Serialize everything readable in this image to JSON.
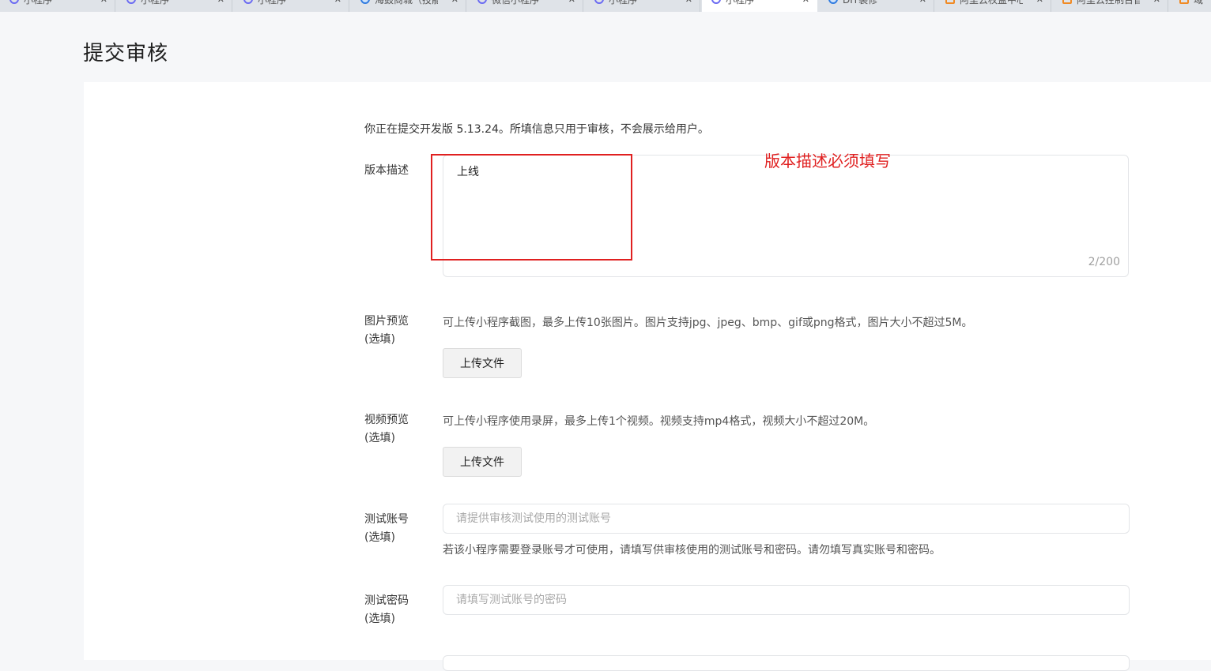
{
  "browser": {
    "tabs": [
      {
        "label": "小程序",
        "icon": "miniprogram-icon",
        "active": false
      },
      {
        "label": "小程序",
        "icon": "miniprogram-icon",
        "active": false
      },
      {
        "label": "小程序",
        "icon": "miniprogram-icon",
        "active": false
      },
      {
        "label": "海鼓商城（技能",
        "icon": "globe-icon",
        "active": false
      },
      {
        "label": "微信小程序",
        "icon": "miniprogram-icon",
        "active": false
      },
      {
        "label": "小程序",
        "icon": "miniprogram-icon",
        "active": false
      },
      {
        "label": "小程序",
        "icon": "miniprogram-icon",
        "active": true
      },
      {
        "label": "DIY装修",
        "icon": "globe-icon",
        "active": false
      },
      {
        "label": "阿里云权益中心",
        "icon": "bracket-icon",
        "active": false
      },
      {
        "label": "阿里云控制台首",
        "icon": "bracket-icon",
        "active": false
      },
      {
        "label": "域",
        "icon": "bracket-icon",
        "active": false
      }
    ],
    "close_glyph": "✕"
  },
  "page": {
    "title": "提交审核",
    "intro": "你正在提交开发版 5.13.24。所填信息只用于审核，不会展示给用户。"
  },
  "form": {
    "description": {
      "label": "版本描述",
      "value": "上线",
      "counter": "2/200"
    },
    "annotation": "版本描述必须填写",
    "images": {
      "label": "图片预览",
      "optional": "(选填)",
      "hint": "可上传小程序截图，最多上传10张图片。图片支持jpg、jpeg、bmp、gif或png格式，图片大小不超过5M。",
      "button": "上传文件"
    },
    "video": {
      "label": "视频预览",
      "optional": "(选填)",
      "hint": "可上传小程序使用录屏，最多上传1个视频。视频支持mp4格式，视频大小不超过20M。",
      "button": "上传文件"
    },
    "test_account": {
      "label": "测试账号",
      "optional": "(选填)",
      "placeholder": "请提供审核测试使用的测试账号",
      "help": "若该小程序需要登录账号才可使用，请填写供审核使用的测试账号和密码。请勿填写真实账号和密码。"
    },
    "test_password": {
      "label": "测试密码",
      "optional": "(选填)",
      "placeholder": "请填写测试账号的密码"
    }
  },
  "colors": {
    "annotation_red": "#e02020",
    "page_bg": "#f6f7f9",
    "card_bg": "#ffffff"
  }
}
